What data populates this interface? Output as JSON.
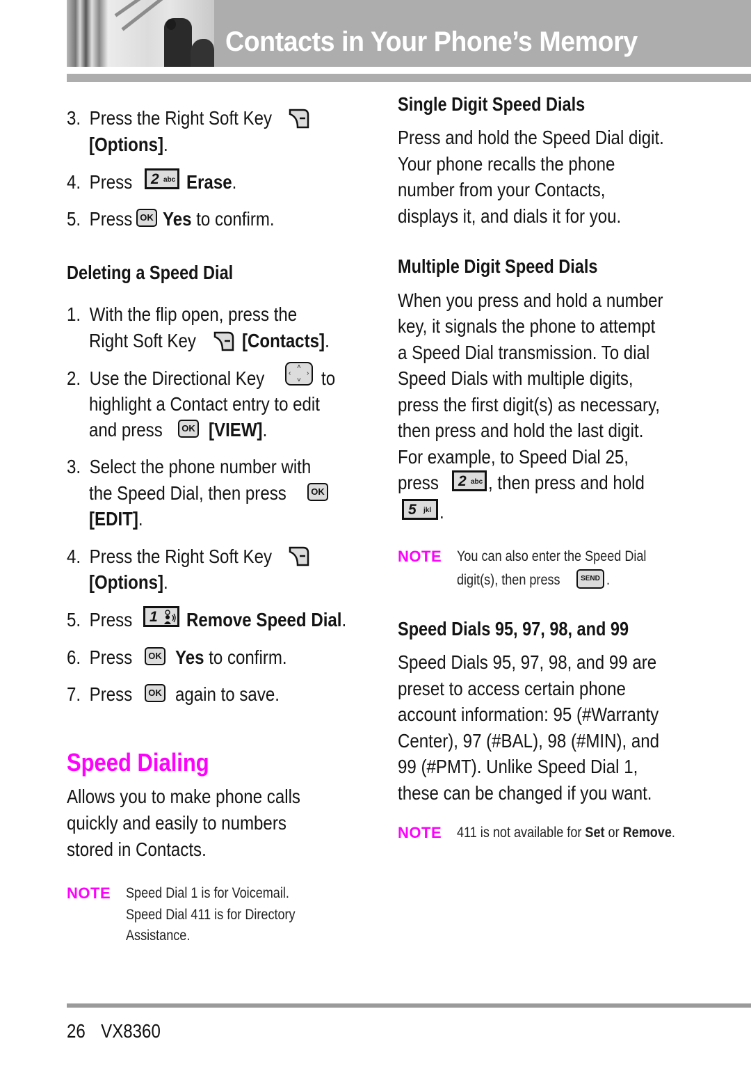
{
  "header": {
    "title": "Contacts in Your Phone’s Memory",
    "photo": "header-photo"
  },
  "left": {
    "intro_steps": [
      {
        "n": "3.",
        "line1": "Press the Right Soft Key",
        "icon": "right-soft-key-icon",
        "line2_bold": "[Options]",
        "line2_tail": "."
      },
      {
        "n": "4.",
        "pre": "Press",
        "icon": "key-2-abc-icon",
        "bold": "Erase",
        "tail": "."
      },
      {
        "n": "5.",
        "pre": "Press",
        "icon": "ok-key-icon",
        "bold": "Yes",
        "tail": " to confirm."
      }
    ],
    "deleting": {
      "heading": "Deleting a Speed Dial",
      "steps": [
        {
          "n": "1.",
          "line1": "With the flip open, press the",
          "line2_pre": "Right Soft Key",
          "icon": "right-soft-key-icon",
          "line2_bold": "[Contacts]",
          "line2_tail": "."
        },
        {
          "n": "2.",
          "line1_pre": "Use the Directional Key",
          "icon": "directional-key-icon",
          "line1_tail": "to",
          "line2": "highlight a Contact entry to edit",
          "line3_pre": "and press",
          "icon2": "ok-key-icon",
          "line3_bold": "[VIEW]",
          "line3_tail": "."
        },
        {
          "n": "3.",
          "line1": "Select the phone number with",
          "line2": "the Speed Dial, then press",
          "icon": "ok-key-icon",
          "line3_bold": "[EDIT]",
          "line3_tail": "."
        },
        {
          "n": "4.",
          "line1": "Press the Right Soft Key",
          "icon": "right-soft-key-icon",
          "line2_bold": "[Options]",
          "line2_tail": "."
        },
        {
          "n": "5.",
          "pre": "Press",
          "icon": "key-1-voicemail-icon",
          "bold": "Remove Speed Dial",
          "tail": "."
        },
        {
          "n": "6.",
          "pre": "Press",
          "icon": "ok-key-icon",
          "bold": "Yes",
          "tail": " to confirm."
        },
        {
          "n": "7.",
          "pre": "Press",
          "icon": "ok-key-icon",
          "tail": "again to save."
        }
      ]
    },
    "speed_dialing": {
      "heading": "Speed Dialing",
      "body_lines": [
        "Allows you to make phone calls",
        "quickly and easily to numbers",
        "stored in Contacts."
      ],
      "note_label": "NOTE",
      "note_lines": [
        "Speed Dial 1 is for Voicemail.",
        "Speed Dial 411 is for Directory",
        "Assistance."
      ]
    }
  },
  "right": {
    "single": {
      "heading": "Single Digit Speed Dials",
      "body_lines": [
        "Press and hold the Speed Dial digit.",
        "Your phone recalls the phone",
        "number from your Contacts,",
        "displays it, and dials it for you."
      ]
    },
    "multiple": {
      "heading": "Multiple Digit Speed Dials",
      "body_lines": [
        "When you press and hold a number",
        "key, it signals the phone to attempt",
        "a Speed Dial transmission. To dial",
        "Speed Dials with multiple digits,",
        "press the first digit(s) as necessary,",
        "then press and hold the last digit.",
        "For example, to Speed Dial 25,"
      ],
      "line_press_pre": "press",
      "line_press_tail": ", then press and hold",
      "last_tail": ".",
      "note_label": "NOTE",
      "note_line1": "You can also enter the Speed Dial",
      "note_line2_pre": "digit(s), then press",
      "note_line2_tail": "."
    },
    "special": {
      "heading": "Speed Dials 95, 97, 98, and 99",
      "body_lines": [
        "Speed Dials 95, 97, 98, and 99 are",
        "preset to access certain phone",
        "account information: 95 (#Warranty",
        "Center), 97 (#BAL), 98 (#MIN), and",
        "99 (#PMT). Unlike Speed Dial 1,",
        "these can be changed if you want."
      ],
      "note_label": "NOTE",
      "note_pre": "411 is not available for ",
      "note_b1": "Set",
      "note_mid": " or ",
      "note_b2": "Remove",
      "note_tail": "."
    }
  },
  "keys": {
    "ok": "OK",
    "send": "SEND",
    "k2_digit": "2",
    "k2_letters": "abc",
    "k5_digit": "5",
    "k5_letters": "jkl",
    "k1_digit": "1"
  },
  "footer": {
    "page_number": "26",
    "model": "VX8360"
  },
  "colors": {
    "accent_magenta": "#ff00ff",
    "header_gray": "#adadad",
    "footer_rule": "#9a9a9a"
  }
}
